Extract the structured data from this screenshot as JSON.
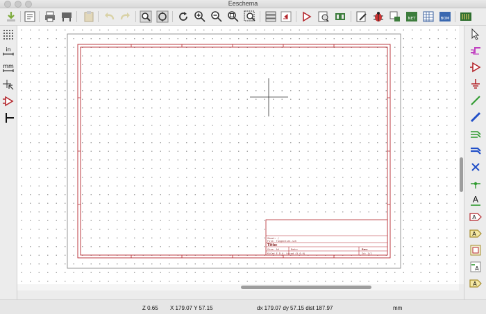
{
  "window": {
    "title": "Eeschema"
  },
  "title_block": {
    "sheet": "Sheet: /",
    "file": "File: Tangential.sch",
    "title_label": "Title:",
    "size_label": "Size: A4",
    "date_label": "Date:",
    "rev_label": "Rev:",
    "kicad_label": "KiCad E.D.A.  kicad (5.0.0)",
    "id_label": "Id: 1/1"
  },
  "status": {
    "zoom": "Z 0.65",
    "cursor": "X 179.07  Y 57.15",
    "delta": "dx 179.07  dy 57.15  dist 187.97",
    "units": "mm"
  },
  "left_toolbar": {
    "inch_label": "in",
    "mm_label": "mm"
  },
  "right_toolbar": {
    "text_label": "A"
  },
  "toolbar": {
    "net_label": "NET",
    "bom_label": "BOM"
  },
  "colors": {
    "sheet_border": "#b4262c",
    "page_outline": "#7a7a7a"
  }
}
